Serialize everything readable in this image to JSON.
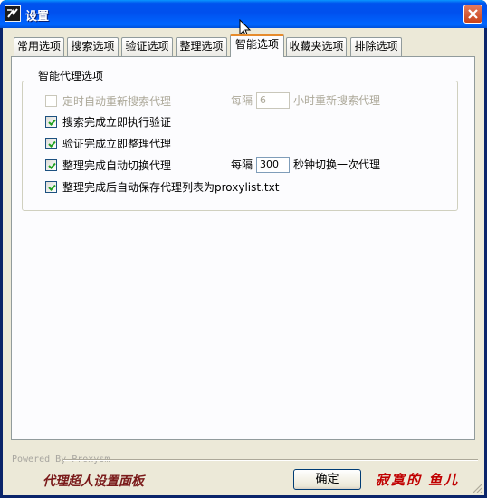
{
  "window": {
    "title": "设置"
  },
  "tabs": [
    {
      "label": "常用选项"
    },
    {
      "label": "搜索选项"
    },
    {
      "label": "验证选项"
    },
    {
      "label": "整理选项"
    },
    {
      "label": "智能选项"
    },
    {
      "label": "收藏夹选项"
    },
    {
      "label": "排除选项"
    }
  ],
  "active_tab": "智能选项",
  "group": {
    "title": "智能代理选项",
    "options": [
      {
        "label": "定时自动重新搜索代理",
        "checked": false,
        "enabled": false
      },
      {
        "label": "搜索完成立即执行验证",
        "checked": true,
        "enabled": true
      },
      {
        "label": "验证完成立即整理代理",
        "checked": true,
        "enabled": true
      },
      {
        "label": "整理完成自动切换代理",
        "checked": true,
        "enabled": true
      },
      {
        "label": "整理完成后自动保存代理列表为proxylist.txt",
        "checked": true,
        "enabled": true
      }
    ],
    "research_interval": {
      "prefix": "每隔",
      "value": "6",
      "suffix": "小时重新搜索代理"
    },
    "switch_interval": {
      "prefix": "每隔",
      "value": "300",
      "suffix": "秒钟切换一次代理"
    }
  },
  "footer": {
    "powered_by": "Powered By Proxysm",
    "left_caption": "代理超人设置面板",
    "ok_label": "确定",
    "right_caption": "寂寞的 鱼儿"
  },
  "icons": {
    "app": "app-logo-icon",
    "close": "close-icon",
    "cursor": "mouse-cursor-icon",
    "check": "checkmark-icon",
    "grip": "resize-grip-icon"
  },
  "colors": {
    "titlebar": "#0054e3",
    "dialog_bg": "#ece9d8",
    "tab_accent": "#e68b2c",
    "left_caption": "#7a1a1a",
    "right_caption": "#c00000"
  }
}
